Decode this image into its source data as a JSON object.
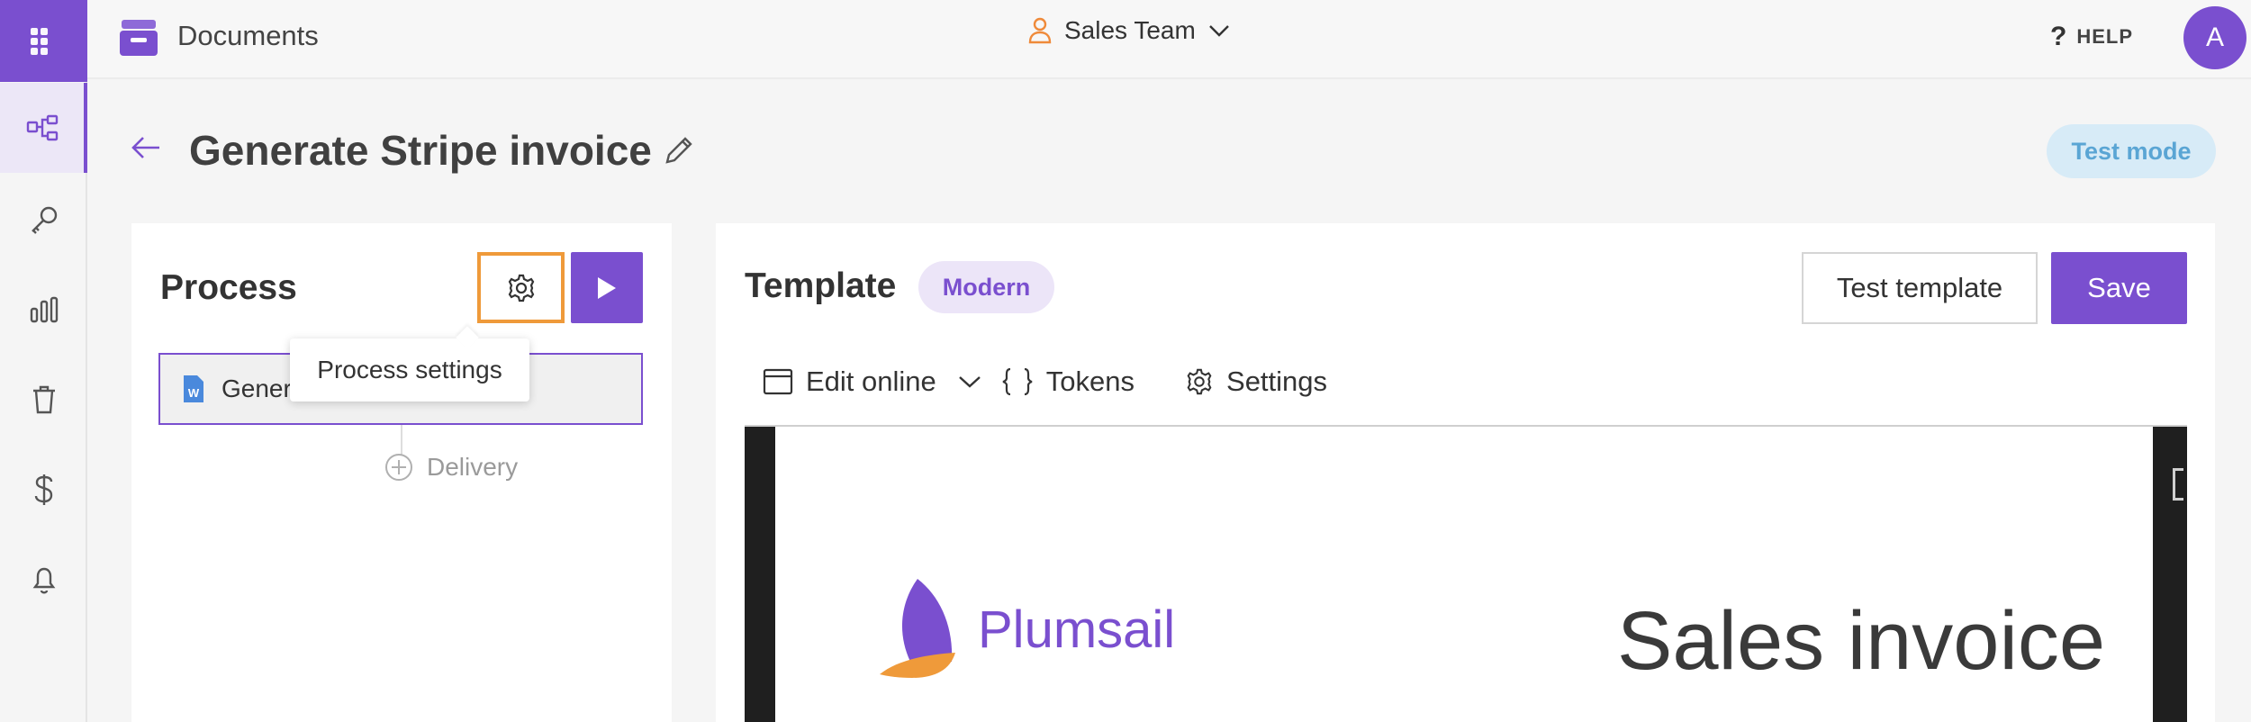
{
  "app": {
    "name": "Documents"
  },
  "team": {
    "label": "Sales Team"
  },
  "header": {
    "help_label": "HELP",
    "avatar_initial": "A"
  },
  "page": {
    "title": "Generate Stripe invoice",
    "test_mode_label": "Test mode"
  },
  "process": {
    "title": "Process",
    "tooltip": "Process settings",
    "step_label": "Gener",
    "delivery_label": "Delivery"
  },
  "template": {
    "title": "Template",
    "badge": "Modern",
    "test_button": "Test template",
    "save_button": "Save",
    "toolbar": {
      "edit_online": "Edit online",
      "tokens": "Tokens",
      "settings": "Settings"
    }
  },
  "document": {
    "brand": "Plumsail",
    "title": "Sales invoice"
  },
  "colors": {
    "accent": "#7a4fcf",
    "highlight": "#ef9a3a",
    "test_mode_bg": "#d7ebf7"
  }
}
